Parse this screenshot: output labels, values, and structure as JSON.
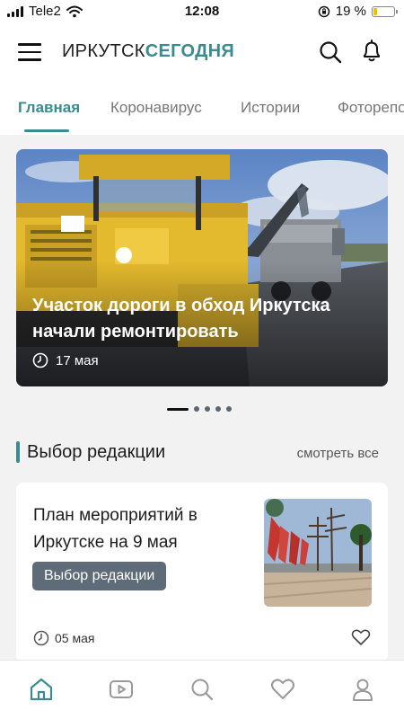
{
  "status_bar": {
    "carrier": "Tele2",
    "time": "12:08",
    "battery": "19 %",
    "battery_level": 0.19
  },
  "header": {
    "logo_part1": "ИРКУТСК",
    "logo_part2": "СЕГОДНЯ",
    "icons": [
      "menu-icon",
      "search-icon",
      "bell-icon"
    ]
  },
  "tabs": [
    {
      "label": "Главная",
      "active": true
    },
    {
      "label": "Коронавирус",
      "active": false
    },
    {
      "label": "Истории",
      "active": false
    },
    {
      "label": "Фоторепо",
      "active": false
    }
  ],
  "hero": {
    "title": "Участок дороги в обход Иркутска начали ремонтировать",
    "date": "17 мая",
    "slides": 5,
    "active_slide": 1
  },
  "editors_choice": {
    "title": "Выбор редакции",
    "see_all": "смотреть все",
    "card": {
      "title": "План мероприятий в Иркутске на 9 мая",
      "tag": "Выбор редакции",
      "date": "05 мая"
    }
  },
  "bottom_nav": [
    "home-icon",
    "video-icon",
    "search-icon",
    "heart-icon",
    "profile-icon"
  ],
  "colors": {
    "accent": "#3c8a8e",
    "tag_bg": "#5d6c78",
    "battery": "#f0c000"
  }
}
